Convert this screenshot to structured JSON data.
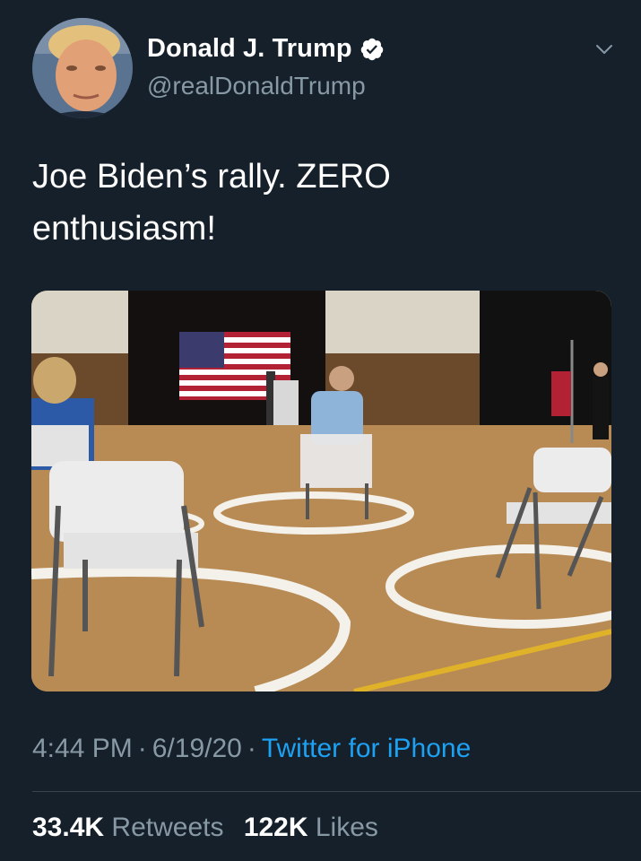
{
  "user": {
    "display_name": "Donald J. Trump",
    "handle": "@realDonaldTrump",
    "verified": true
  },
  "tweet": {
    "text_line1": "Joe Biden’s rally. ZERO",
    "text_line2": "enthusiasm!",
    "time": "4:44 PM",
    "date": "6/19/20",
    "source": "Twitter for iPhone",
    "separator": "·"
  },
  "stats": {
    "retweets_count": "33.4K",
    "retweets_label": "Retweets",
    "likes_count": "122K",
    "likes_label": "Likes"
  },
  "icons": {
    "verified": "verified-badge-icon",
    "menu": "chevron-down-icon"
  },
  "colors": {
    "background": "#15202b",
    "secondary_text": "#8899a6",
    "link": "#1da1f2",
    "divider": "#38444d"
  }
}
